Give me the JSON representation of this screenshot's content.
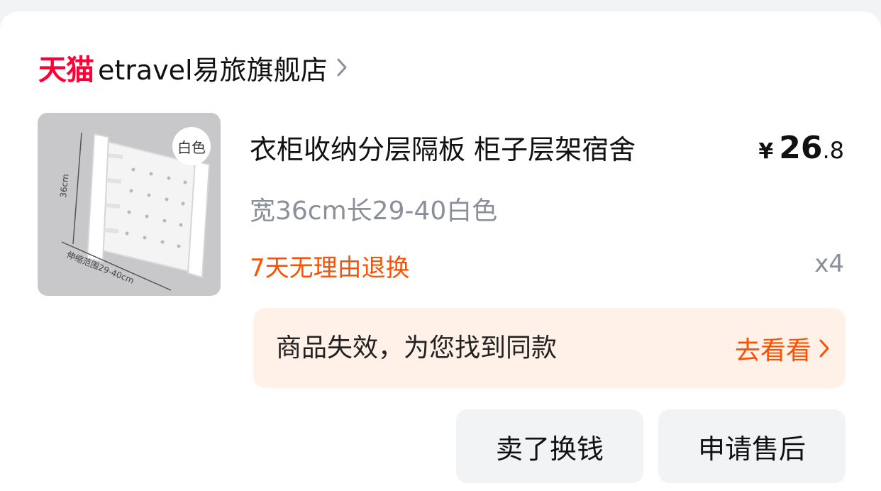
{
  "shop": {
    "platform_logo": "天猫",
    "name": "etravel易旅旗舰店",
    "chevron_icon": "chevron-right-icon"
  },
  "product": {
    "thumbnail_badge": "白色",
    "thumbnail_dim_height": "36cm",
    "thumbnail_dim_range": "伸缩范围29-40cm",
    "title": "衣柜收纳分层隔板 柜子层架宿舍",
    "price_currency": "¥",
    "price_integer": "26",
    "price_decimal": ".8",
    "spec": "宽36cm长29-40白色",
    "return_policy": "7天无理由退换",
    "quantity": "x4"
  },
  "notice": {
    "text": "商品失效，为您找到同款",
    "link_label": "去看看"
  },
  "actions": {
    "sell_label": "卖了换钱",
    "after_sale_label": "申请售后"
  },
  "colors": {
    "tmall_red": "#ff0036",
    "accent_orange": "#ff5000",
    "notice_bg": "#fff0e8",
    "muted_text": "#8a8f9a"
  }
}
